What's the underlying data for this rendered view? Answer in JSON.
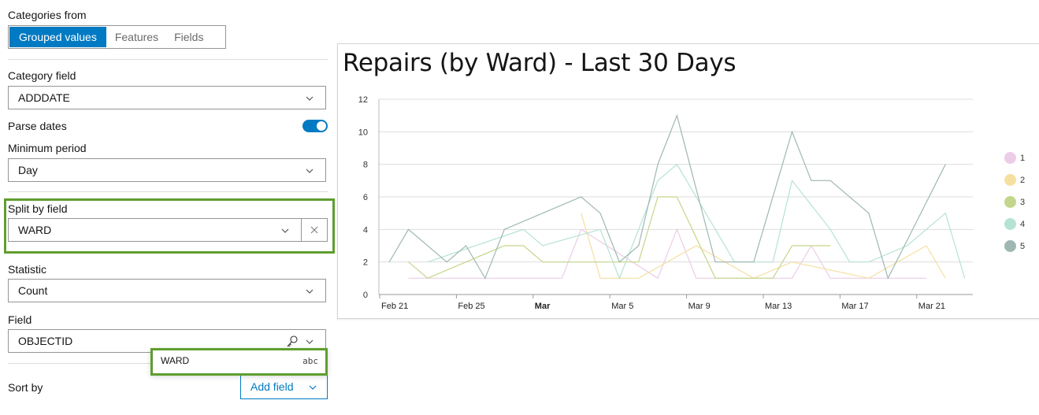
{
  "config": {
    "categories_from": {
      "label": "Categories from",
      "options": [
        "Grouped values",
        "Features",
        "Fields"
      ],
      "selected": "Grouped values"
    },
    "category_field": {
      "label": "Category field",
      "value": "ADDDATE"
    },
    "parse_dates": {
      "label": "Parse dates",
      "enabled": true
    },
    "minimum_period": {
      "label": "Minimum period",
      "value": "Day"
    },
    "split_by_field": {
      "label": "Split by field",
      "value": "WARD",
      "clear_icon": "close-icon"
    },
    "statistic": {
      "label": "Statistic",
      "value": "Count"
    },
    "field": {
      "label": "Field",
      "value": "OBJECTID",
      "type_icon": "key-icon"
    },
    "field_dropdown": {
      "option": "WARD",
      "type": "abc"
    },
    "sort_by": {
      "label": "Sort by",
      "add_field_label": "Add field"
    }
  },
  "colors": {
    "accent": "#007ac2",
    "highlight": "#5f9e2f",
    "series": [
      "#ebcde8",
      "#f5e0a0",
      "#c3d68b",
      "#b5e3d1",
      "#9fb7b3"
    ]
  },
  "chart_data": {
    "type": "line",
    "title": "Repairs (by Ward) - Last 30 Days",
    "xlabel": "",
    "ylabel": "",
    "ylim": [
      0,
      12
    ],
    "yticks": [
      0,
      2,
      4,
      6,
      8,
      10,
      12
    ],
    "xlim_days": [
      "Feb 21",
      "Mar 24"
    ],
    "xticks": [
      {
        "label": "Feb 21",
        "day": 0,
        "bold": false
      },
      {
        "label": "Feb 25",
        "day": 4,
        "bold": false
      },
      {
        "label": "Mar",
        "day": 8,
        "bold": true
      },
      {
        "label": "Mar 5",
        "day": 12,
        "bold": false
      },
      {
        "label": "Mar 9",
        "day": 16,
        "bold": false
      },
      {
        "label": "Mar 13",
        "day": 20,
        "bold": false
      },
      {
        "label": "Mar 17",
        "day": 24,
        "bold": false
      },
      {
        "label": "Mar 21",
        "day": 28,
        "bold": false
      }
    ],
    "grid": true,
    "legend_position": "right",
    "series": [
      {
        "name": "1",
        "points": [
          [
            "Feb 22",
            1
          ],
          [
            "Mar 2",
            1
          ],
          [
            "Mar 3",
            4
          ],
          [
            "Mar 7",
            1
          ],
          [
            "Mar 8",
            4
          ],
          [
            "Mar 9",
            1
          ],
          [
            "Mar 14",
            1
          ],
          [
            "Mar 15",
            3
          ],
          [
            "Mar 16",
            1
          ],
          [
            "Mar 21",
            1
          ]
        ]
      },
      {
        "name": "2",
        "points": [
          [
            "Mar 3",
            5
          ],
          [
            "Mar 4",
            1
          ],
          [
            "Mar 6",
            1
          ],
          [
            "Mar 9",
            3
          ],
          [
            "Mar 12",
            1
          ],
          [
            "Mar 14",
            2
          ],
          [
            "Mar 18",
            1
          ],
          [
            "Mar 21",
            3
          ],
          [
            "Mar 22",
            1
          ]
        ]
      },
      {
        "name": "3",
        "points": [
          [
            "Feb 22",
            2
          ],
          [
            "Feb 23",
            1
          ],
          [
            "Feb 27",
            3
          ],
          [
            "Feb 28",
            3
          ],
          [
            "Mar 1",
            2
          ],
          [
            "Mar 6",
            2
          ],
          [
            "Mar 7",
            6
          ],
          [
            "Mar 8",
            6
          ],
          [
            "Mar 10",
            1
          ],
          [
            "Mar 13",
            1
          ],
          [
            "Mar 14",
            3
          ],
          [
            "Mar 16",
            3
          ]
        ]
      },
      {
        "name": "4",
        "points": [
          [
            "Feb 23",
            2
          ],
          [
            "Feb 28",
            4
          ],
          [
            "Mar 1",
            3
          ],
          [
            "Mar 4",
            4
          ],
          [
            "Mar 5",
            1
          ],
          [
            "Mar 7",
            7
          ],
          [
            "Mar 8",
            8
          ],
          [
            "Mar 11",
            2
          ],
          [
            "Mar 13",
            2
          ],
          [
            "Mar 14",
            7
          ],
          [
            "Mar 16",
            4
          ],
          [
            "Mar 17",
            2
          ],
          [
            "Mar 18",
            2
          ],
          [
            "Mar 20",
            3
          ],
          [
            "Mar 22",
            5
          ],
          [
            "Mar 23",
            1
          ]
        ]
      },
      {
        "name": "5",
        "points": [
          [
            "Feb 21",
            2
          ],
          [
            "Feb 22",
            4
          ],
          [
            "Feb 24",
            2
          ],
          [
            "Feb 25",
            3
          ],
          [
            "Feb 26",
            1
          ],
          [
            "Feb 27",
            4
          ],
          [
            "Mar 3",
            6
          ],
          [
            "Mar 4",
            5
          ],
          [
            "Mar 5",
            2
          ],
          [
            "Mar 6",
            3
          ],
          [
            "Mar 7",
            8
          ],
          [
            "Mar 8",
            11
          ],
          [
            "Mar 10",
            2
          ],
          [
            "Mar 12",
            2
          ],
          [
            "Mar 14",
            10
          ],
          [
            "Mar 15",
            7
          ],
          [
            "Mar 16",
            7
          ],
          [
            "Mar 18",
            5
          ],
          [
            "Mar 19",
            1
          ],
          [
            "Mar 22",
            8
          ]
        ]
      }
    ]
  }
}
